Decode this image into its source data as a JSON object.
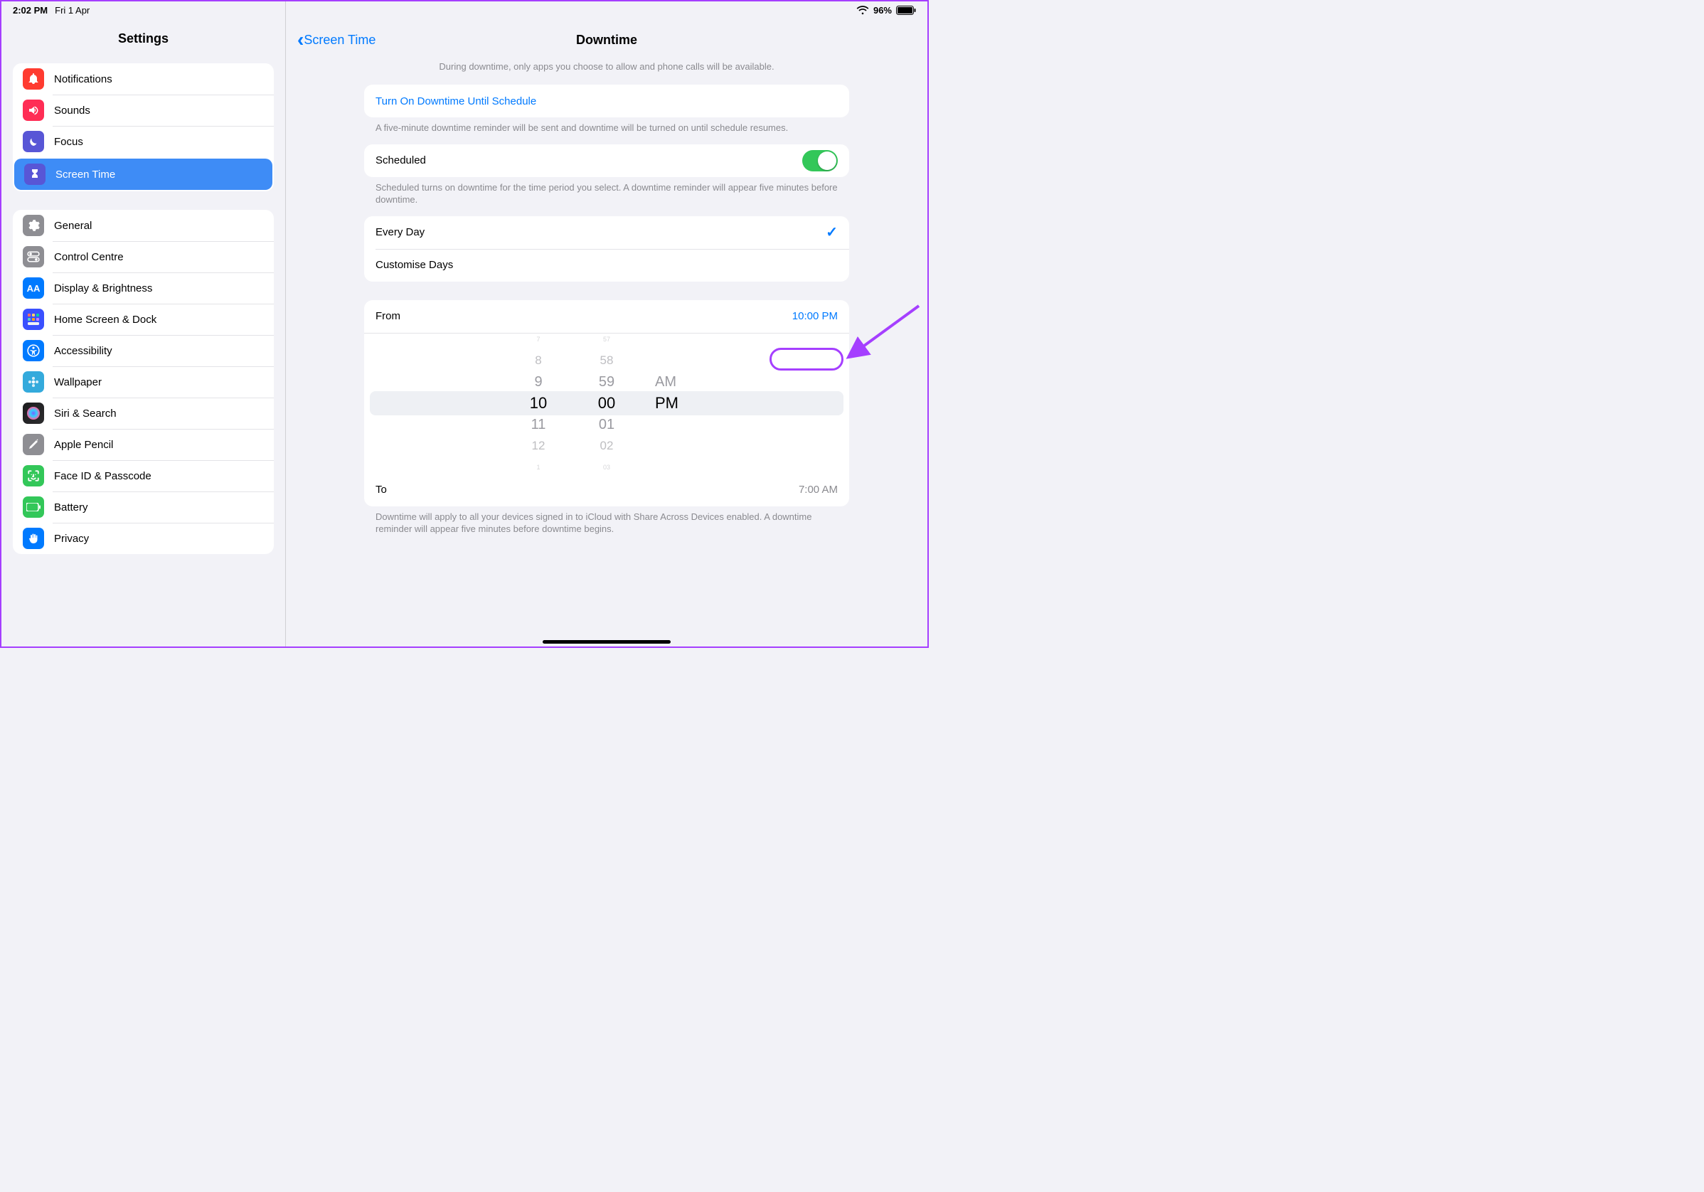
{
  "status": {
    "time": "2:02 PM",
    "date": "Fri 1 Apr",
    "battery_pct": "96%"
  },
  "sidebar": {
    "title": "Settings",
    "group1": [
      {
        "label": "Notifications"
      },
      {
        "label": "Sounds"
      },
      {
        "label": "Focus"
      },
      {
        "label": "Screen Time",
        "selected": true
      }
    ],
    "group2": [
      {
        "label": "General"
      },
      {
        "label": "Control Centre"
      },
      {
        "label": "Display & Brightness"
      },
      {
        "label": "Home Screen & Dock"
      },
      {
        "label": "Accessibility"
      },
      {
        "label": "Wallpaper"
      },
      {
        "label": "Siri & Search"
      },
      {
        "label": "Apple Pencil"
      },
      {
        "label": "Face ID & Passcode"
      },
      {
        "label": "Battery"
      },
      {
        "label": "Privacy"
      }
    ]
  },
  "content": {
    "back_label": "Screen Time",
    "title": "Downtime",
    "intro": "During downtime, only apps you choose to allow and phone calls will be available.",
    "turn_on_label": "Turn On Downtime Until Schedule",
    "turn_on_footer": "A five-minute downtime reminder will be sent and downtime will be turned on until schedule resumes.",
    "scheduled_label": "Scheduled",
    "scheduled_on": true,
    "scheduled_footer": "Scheduled turns on downtime for the time period you select. A downtime reminder will appear five minutes before downtime.",
    "mode_everyday": "Every Day",
    "mode_custom": "Customise Days",
    "from_label": "From",
    "from_value": "10:00 PM",
    "to_label": "To",
    "to_value": "7:00 AM",
    "to_footer": "Downtime will apply to all your devices signed in to iCloud with Share Across Devices enabled. A downtime reminder will appear five minutes before downtime begins.",
    "picker": {
      "hours": [
        "7",
        "8",
        "9",
        "10",
        "11",
        "12",
        "1"
      ],
      "minutes": [
        "57",
        "58",
        "59",
        "00",
        "01",
        "02",
        "03"
      ],
      "ampm": [
        "AM",
        "PM"
      ]
    }
  }
}
